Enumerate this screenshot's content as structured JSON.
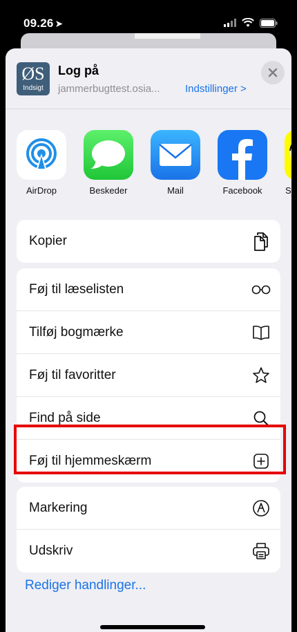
{
  "status": {
    "time": "09.26"
  },
  "header": {
    "app_icon_top": "ØS",
    "app_icon_bottom": "Indsigt",
    "title": "Log på",
    "subtitle": "jammerbugttest.osia...",
    "settings_link": "Indstillinger >"
  },
  "share_apps": [
    {
      "label": "AirDrop",
      "icon": "airdrop-icon"
    },
    {
      "label": "Beskeder",
      "icon": "messages-icon"
    },
    {
      "label": "Mail",
      "icon": "mail-icon"
    },
    {
      "label": "Facebook",
      "icon": "facebook-icon"
    },
    {
      "label": "Sn",
      "icon": "snapchat-icon"
    }
  ],
  "actions": {
    "copy": {
      "label": "Kopier",
      "icon": "copy-icon"
    },
    "reading_list": {
      "label": "Føj til læselisten",
      "icon": "glasses-icon"
    },
    "bookmark": {
      "label": "Tilføj bogmærke",
      "icon": "book-icon"
    },
    "favorites": {
      "label": "Føj til favoritter",
      "icon": "star-icon"
    },
    "find": {
      "label": "Find på side",
      "icon": "search-icon"
    },
    "home_screen": {
      "label": "Føj til hjemmeskærm",
      "icon": "plus-square-icon"
    },
    "markup": {
      "label": "Markering",
      "icon": "markup-icon"
    },
    "print": {
      "label": "Udskriv",
      "icon": "printer-icon"
    }
  },
  "edit_actions_link": "Rediger handlinger...",
  "colors": {
    "accent": "#1a73e8",
    "highlight": "#e60000",
    "sheet_bg": "#efeff4"
  }
}
